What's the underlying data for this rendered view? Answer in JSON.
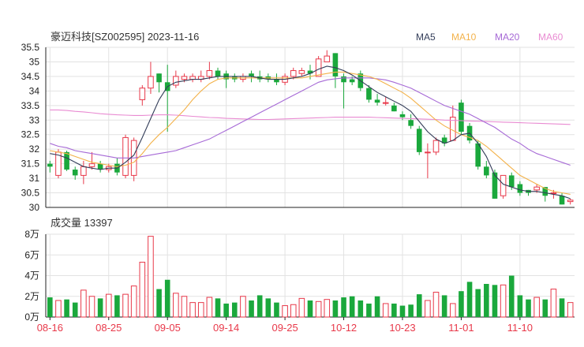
{
  "chart_data": [
    {
      "type": "candlestick",
      "title": "豪迈科技[SZ002595] 2023-11-16",
      "colors": {
        "up": "#e8394a",
        "down": "#1aa83c",
        "ma5": "#333d59",
        "ma10": "#f3b24a",
        "ma20": "#a669d6",
        "ma60": "#e98bd2",
        "grid": "#e2e2e2",
        "axis": "#222222"
      },
      "y_ticks": [
        "35.5",
        "35",
        "34.5",
        "34",
        "33.5",
        "33",
        "32.5",
        "32",
        "31.5",
        "31",
        "30.5",
        "30"
      ],
      "ylim": [
        30,
        35.5
      ],
      "legend": [
        {
          "name": "MA5",
          "color": "#333d59"
        },
        {
          "name": "MA10",
          "color": "#f3b24a"
        },
        {
          "name": "MA20",
          "color": "#a669d6"
        },
        {
          "name": "MA60",
          "color": "#e98bd2"
        }
      ],
      "candles": [
        [
          31.5,
          31.4,
          31.6,
          31.2
        ],
        [
          31.1,
          31.9,
          32.0,
          31.0
        ],
        [
          31.9,
          31.3,
          31.95,
          31.25
        ],
        [
          31.3,
          31.1,
          31.4,
          30.95
        ],
        [
          31.1,
          31.4,
          31.6,
          30.8
        ],
        [
          31.4,
          31.5,
          31.9,
          31.3
        ],
        [
          31.5,
          31.3,
          31.6,
          31.2
        ],
        [
          31.3,
          31.4,
          31.5,
          31.2
        ],
        [
          31.5,
          31.2,
          31.7,
          31.1
        ],
        [
          31.1,
          32.4,
          32.5,
          31.0
        ],
        [
          31.1,
          32.3,
          32.4,
          30.9
        ],
        [
          33.7,
          34.1,
          34.2,
          33.5
        ],
        [
          34.1,
          34.5,
          35.0,
          33.9
        ],
        [
          34.6,
          34.3,
          34.6,
          33.95
        ],
        [
          34.3,
          34.0,
          34.9,
          32.6
        ],
        [
          34.2,
          34.5,
          34.7,
          34.1
        ],
        [
          34.4,
          34.5,
          34.6,
          34.3
        ],
        [
          34.4,
          34.5,
          34.6,
          34.3
        ],
        [
          34.4,
          34.5,
          34.7,
          34.3
        ],
        [
          34.5,
          34.7,
          35.0,
          34.4
        ],
        [
          34.7,
          34.5,
          34.8,
          34.4
        ],
        [
          34.6,
          34.4,
          34.7,
          34.1
        ],
        [
          34.5,
          34.4,
          34.6,
          34.3
        ],
        [
          34.4,
          34.5,
          34.6,
          34.3
        ],
        [
          34.6,
          34.5,
          34.7,
          34.3
        ],
        [
          34.5,
          34.4,
          34.7,
          34.3
        ],
        [
          34.5,
          34.4,
          34.6,
          34.3
        ],
        [
          34.4,
          34.3,
          34.6,
          34.2
        ],
        [
          34.3,
          34.5,
          34.6,
          34.2
        ],
        [
          34.5,
          34.7,
          34.8,
          34.4
        ],
        [
          34.6,
          34.7,
          34.8,
          34.5
        ],
        [
          34.7,
          34.6,
          34.9,
          34.4
        ],
        [
          34.5,
          35.1,
          35.2,
          34.5
        ],
        [
          35.0,
          35.2,
          35.4,
          35.0
        ],
        [
          35.3,
          34.5,
          35.3,
          34.1
        ],
        [
          34.5,
          34.3,
          34.6,
          33.4
        ],
        [
          34.4,
          34.3,
          34.5,
          34.2
        ],
        [
          34.6,
          34.1,
          34.7,
          34.0
        ],
        [
          34.1,
          33.7,
          34.2,
          33.6
        ],
        [
          33.7,
          33.6,
          33.9,
          33.5
        ],
        [
          33.6,
          33.6,
          33.8,
          33.5
        ],
        [
          33.5,
          33.3,
          33.6,
          33.3
        ],
        [
          33.2,
          33.1,
          33.3,
          33.0
        ],
        [
          33.0,
          32.8,
          33.2,
          32.7
        ],
        [
          32.7,
          31.9,
          32.8,
          31.8
        ],
        [
          31.9,
          31.9,
          32.2,
          31.0
        ],
        [
          31.9,
          32.3,
          32.4,
          31.8
        ],
        [
          32.4,
          32.2,
          32.5,
          32.1
        ],
        [
          32.3,
          33.1,
          33.5,
          32.3
        ],
        [
          33.6,
          32.6,
          33.7,
          32.5
        ],
        [
          32.8,
          32.3,
          32.9,
          32.2
        ],
        [
          32.2,
          31.4,
          32.3,
          31.3
        ],
        [
          31.4,
          31.1,
          31.6,
          31.0
        ],
        [
          31.2,
          30.3,
          31.3,
          30.3
        ],
        [
          30.4,
          31.1,
          31.1,
          30.3
        ],
        [
          31.1,
          30.7,
          31.2,
          30.6
        ],
        [
          30.8,
          30.5,
          30.9,
          30.4
        ],
        [
          30.6,
          30.5,
          30.6,
          30.4
        ],
        [
          30.6,
          30.7,
          30.8,
          30.5
        ],
        [
          30.7,
          30.4,
          30.7,
          30.2
        ],
        [
          30.5,
          30.5,
          30.6,
          30.3
        ],
        [
          30.4,
          30.1,
          30.5,
          30.1
        ],
        [
          30.2,
          30.25,
          30.3,
          30.1
        ]
      ],
      "ma5": [
        31.85,
        31.8,
        31.7,
        31.55,
        31.4,
        31.35,
        31.3,
        31.35,
        31.35,
        31.55,
        31.8,
        32.4,
        33.05,
        33.7,
        34.15,
        34.3,
        34.35,
        34.4,
        34.4,
        34.45,
        34.5,
        34.5,
        34.5,
        34.5,
        34.5,
        34.45,
        34.4,
        34.4,
        34.4,
        34.45,
        34.5,
        34.6,
        34.75,
        34.85,
        34.8,
        34.7,
        34.55,
        34.35,
        34.15,
        33.95,
        33.8,
        33.65,
        33.5,
        33.3,
        32.95,
        32.6,
        32.35,
        32.2,
        32.3,
        32.5,
        32.55,
        32.2,
        31.75,
        31.1,
        30.8,
        30.7,
        30.6,
        30.55,
        30.55,
        30.5,
        30.45,
        30.4,
        30.3
      ],
      "ma10": [
        31.95,
        31.9,
        31.85,
        31.75,
        31.65,
        31.55,
        31.5,
        31.45,
        31.4,
        31.45,
        31.55,
        31.85,
        32.2,
        32.5,
        32.75,
        33.05,
        33.35,
        33.7,
        34.0,
        34.25,
        34.4,
        34.45,
        34.45,
        34.45,
        34.45,
        34.45,
        34.45,
        34.45,
        34.45,
        34.45,
        34.45,
        34.5,
        34.55,
        34.6,
        34.65,
        34.65,
        34.6,
        34.55,
        34.5,
        34.4,
        34.25,
        34.1,
        33.95,
        33.75,
        33.5,
        33.25,
        33.0,
        32.8,
        32.65,
        32.5,
        32.4,
        32.3,
        32.1,
        31.85,
        31.6,
        31.35,
        31.1,
        30.95,
        30.8,
        30.65,
        30.55,
        30.5,
        30.45
      ],
      "ma20": [
        32.2,
        32.1,
        32.05,
        31.95,
        31.9,
        31.85,
        31.8,
        31.75,
        31.7,
        31.7,
        31.7,
        31.75,
        31.8,
        31.85,
        31.9,
        31.95,
        32.05,
        32.15,
        32.25,
        32.35,
        32.5,
        32.65,
        32.8,
        32.95,
        33.1,
        33.25,
        33.4,
        33.55,
        33.7,
        33.85,
        34.0,
        34.15,
        34.3,
        34.38,
        34.42,
        34.45,
        34.45,
        34.45,
        34.45,
        34.42,
        34.38,
        34.3,
        34.2,
        34.1,
        33.95,
        33.8,
        33.65,
        33.5,
        33.4,
        33.3,
        33.2,
        33.05,
        32.9,
        32.75,
        32.55,
        32.35,
        32.2,
        32.0,
        31.85,
        31.75,
        31.65,
        31.55,
        31.45
      ],
      "ma60": [
        33.35,
        33.35,
        33.33,
        33.3,
        33.28,
        33.25,
        33.22,
        33.2,
        33.18,
        33.17,
        33.16,
        33.16,
        33.17,
        33.18,
        33.18,
        33.17,
        33.15,
        33.13,
        33.11,
        33.09,
        33.08,
        33.06,
        33.05,
        33.04,
        33.03,
        33.02,
        33.02,
        33.03,
        33.04,
        33.05,
        33.06,
        33.07,
        33.08,
        33.09,
        33.1,
        33.1,
        33.1,
        33.1,
        33.1,
        33.09,
        33.08,
        33.07,
        33.06,
        33.05,
        33.04,
        33.03,
        33.02,
        33.0,
        32.99,
        32.98,
        32.97,
        32.96,
        32.95,
        32.94,
        32.93,
        32.92,
        32.91,
        32.9,
        32.89,
        32.88,
        32.87,
        32.86,
        32.85
      ]
    },
    {
      "type": "bar",
      "title": "成交量 13397",
      "y_ticks": [
        "8万",
        "6万",
        "4万",
        "2万",
        "0万"
      ],
      "ylim": [
        0,
        80000
      ],
      "volumes": [
        19000,
        16000,
        17000,
        14000,
        26000,
        20000,
        18000,
        22000,
        21000,
        22000,
        30000,
        53000,
        78000,
        27000,
        36000,
        23000,
        20000,
        14000,
        14000,
        19000,
        18000,
        13000,
        14000,
        20000,
        16000,
        21000,
        18000,
        14000,
        11000,
        12000,
        18000,
        16000,
        15000,
        17000,
        16000,
        19000,
        20000,
        16000,
        13000,
        20000,
        13000,
        13000,
        11000,
        12000,
        22000,
        16000,
        24000,
        21000,
        13000,
        25000,
        34000,
        27000,
        32000,
        31000,
        31000,
        40000,
        21000,
        17000,
        19000,
        17000,
        27000,
        18000,
        14000
      ]
    }
  ],
  "x_ticks": [
    {
      "index": 0,
      "label": "08-16"
    },
    {
      "index": 7,
      "label": "08-25"
    },
    {
      "index": 14,
      "label": "09-05"
    },
    {
      "index": 21,
      "label": "09-14"
    },
    {
      "index": 28,
      "label": "09-25"
    },
    {
      "index": 35,
      "label": "10-12"
    },
    {
      "index": 42,
      "label": "10-23"
    },
    {
      "index": 49,
      "label": "11-01"
    },
    {
      "index": 56,
      "label": "11-10"
    }
  ]
}
